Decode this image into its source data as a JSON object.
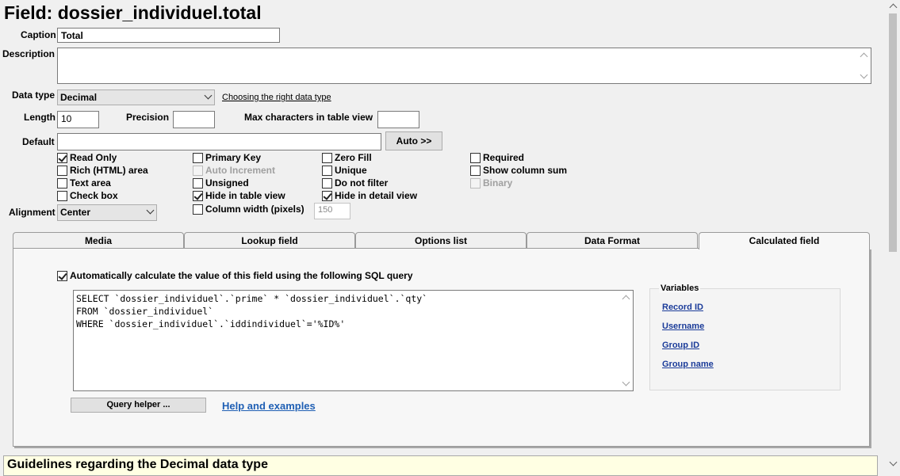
{
  "header": {
    "title": "Field: dossier_individuel.total"
  },
  "caption": {
    "label": "Caption",
    "value": "Total"
  },
  "description": {
    "label": "Description",
    "value": ""
  },
  "data_type": {
    "label": "Data type",
    "value": "Decimal",
    "help_link": "Choosing the right data type"
  },
  "length": {
    "label": "Length",
    "value": "10"
  },
  "precision": {
    "label": "Precision",
    "value": ""
  },
  "max_chars": {
    "label": "Max characters in table view",
    "value": ""
  },
  "default": {
    "label": "Default",
    "value": "",
    "auto_button": "Auto >>"
  },
  "options": {
    "read_only": {
      "label": "Read Only",
      "checked": true
    },
    "rich_html": {
      "label": "Rich (HTML) area",
      "checked": false
    },
    "text_area": {
      "label": "Text area",
      "checked": false
    },
    "check_box": {
      "label": "Check box",
      "checked": false
    },
    "primary_key": {
      "label": "Primary Key",
      "checked": false
    },
    "auto_increment": {
      "label": "Auto Increment",
      "checked": false,
      "disabled": true
    },
    "unsigned": {
      "label": "Unsigned",
      "checked": false
    },
    "hide_table": {
      "label": "Hide in table view",
      "checked": true
    },
    "column_width": {
      "label": "Column width (pixels)",
      "checked": false,
      "value": "150"
    },
    "zero_fill": {
      "label": "Zero Fill",
      "checked": false
    },
    "unique": {
      "label": "Unique",
      "checked": false
    },
    "do_not_filter": {
      "label": "Do not filter",
      "checked": false
    },
    "hide_detail": {
      "label": "Hide in detail view",
      "checked": true
    },
    "required": {
      "label": "Required",
      "checked": false
    },
    "show_column_sum": {
      "label": "Show column sum",
      "checked": false
    },
    "binary": {
      "label": "Binary",
      "checked": false,
      "disabled": true
    }
  },
  "alignment": {
    "label": "Alignment",
    "value": "Center"
  },
  "tabs": [
    {
      "label": "Media",
      "active": false
    },
    {
      "label": "Lookup field",
      "active": false
    },
    {
      "label": "Options list",
      "active": false
    },
    {
      "label": "Data Format",
      "active": false
    },
    {
      "label": "Calculated field",
      "active": true
    }
  ],
  "calculated": {
    "auto_calc_label": "Automatically calculate the value of this field using the following SQL query",
    "auto_calc_checked": true,
    "sql_line1": "SELECT `dossier_individuel`.`prime` * `dossier_individuel`.`qty`",
    "sql_line2": "FROM `dossier_individuel`",
    "sql_line3": "WHERE `dossier_individuel`.`iddindividuel`='%ID%'",
    "query_helper_button": "Query helper ...",
    "help_link": "Help and examples",
    "variables_title": "Variables",
    "variables": [
      "Record ID",
      "Username",
      "Group ID",
      "Group name"
    ]
  },
  "guidelines": {
    "title": "Guidelines regarding the Decimal data type"
  }
}
